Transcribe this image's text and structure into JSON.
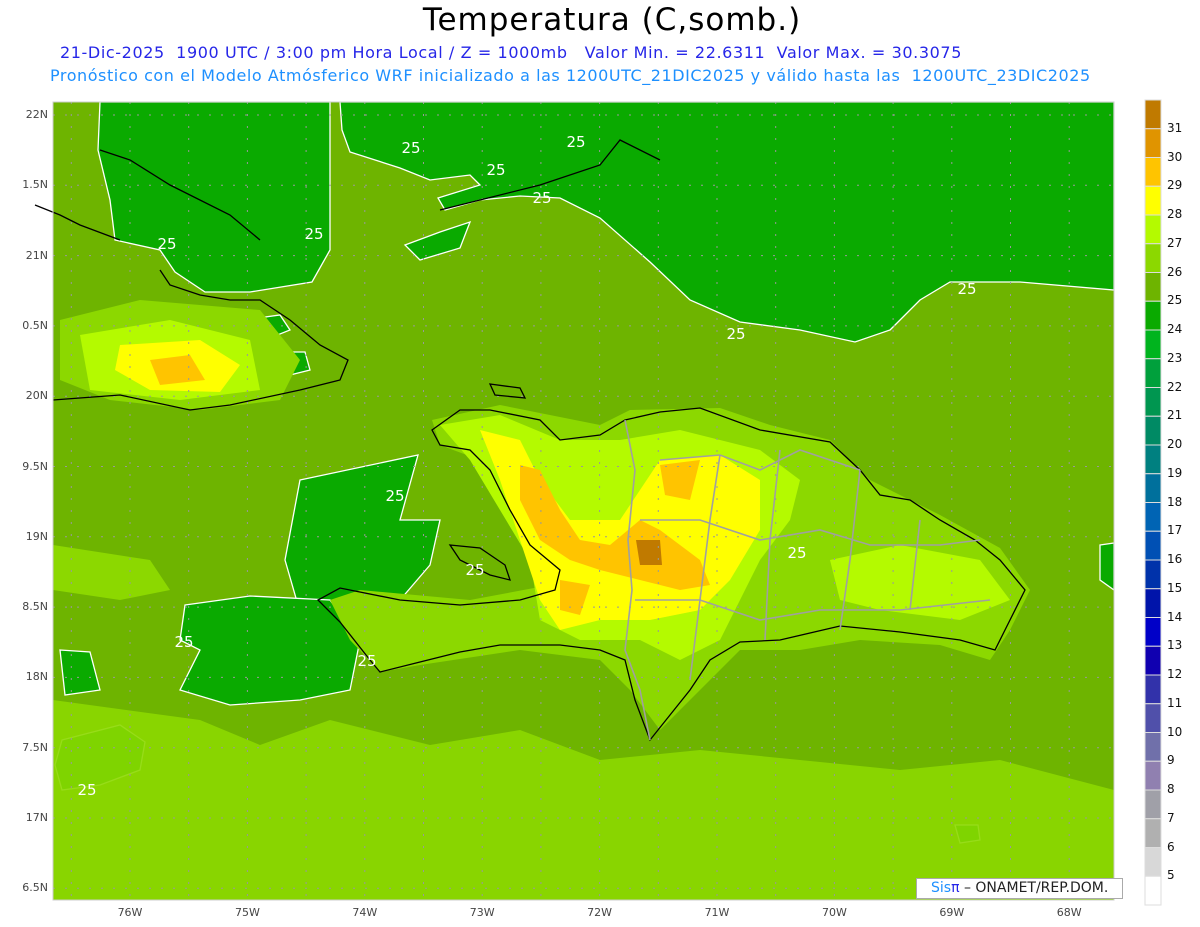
{
  "header": {
    "title": "Temperatura (C,somb.)",
    "line1": "21-Dic-2025  1900 UTC / 3:00 pm Hora Local / Z = 1000mb   Valor Min. = 22.6311  Valor Max. = 30.3075",
    "line2": "Pronóstico con el Modelo Atmósferico WRF inicializado a las 1200UTC_21DIC2025 y válido hasta las  1200UTC_23DIC2025"
  },
  "axes": {
    "lat_labels": [
      "22N",
      "1.5N",
      "21N",
      "0.5N",
      "20N",
      "9.5N",
      "19N",
      "8.5N",
      "18N",
      "7.5N",
      "17N",
      "6.5N"
    ],
    "lon_labels": [
      "76W",
      "75W",
      "74W",
      "73W",
      "72W",
      "71W",
      "70W",
      "69W",
      "68W"
    ]
  },
  "contour_value": "25",
  "colorbar": {
    "labels": [
      "31",
      "30",
      "29",
      "28",
      "27",
      "26",
      "25",
      "24",
      "23",
      "22",
      "21",
      "20",
      "19",
      "18",
      "17",
      "16",
      "15",
      "14",
      "13",
      "12",
      "11",
      "10",
      "9",
      "8",
      "7",
      "6",
      "5"
    ],
    "colors": [
      "#c07a00",
      "#e09400",
      "#ffc400",
      "#ffff00",
      "#b4fa00",
      "#8cd800",
      "#6eb400",
      "#0aaa00",
      "#00b41e",
      "#00a03c",
      "#009650",
      "#008a64",
      "#008080",
      "#00709c",
      "#0064b4",
      "#0050b4",
      "#0032aa",
      "#0014aa",
      "#0000c8",
      "#1000b0",
      "#3232aa",
      "#5050aa",
      "#7070aa",
      "#9080b0",
      "#a0a0a8",
      "#b0b0b0",
      "#d8d8d8",
      "#ffffff"
    ]
  },
  "credit": {
    "sis": "Sis",
    "pi": "π",
    "org": " – ONAMET/REP.DOM."
  }
}
